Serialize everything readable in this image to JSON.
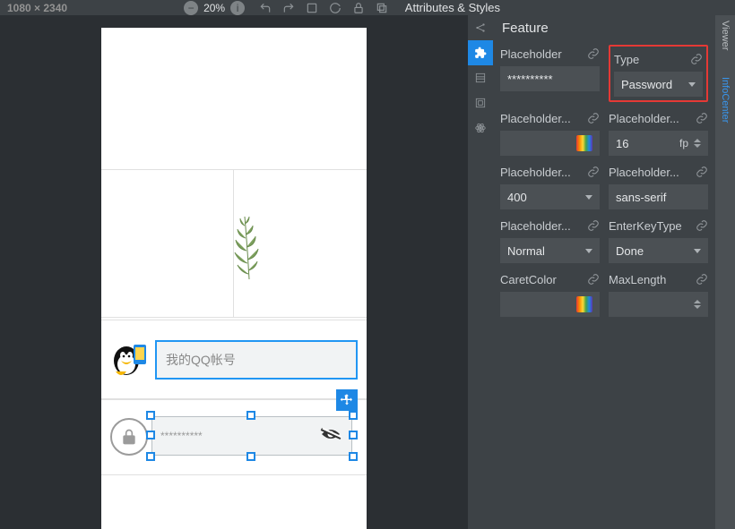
{
  "topbar": {
    "dimensions": "1080 × 2340",
    "zoom": "20%",
    "panel_title": "Attributes & Styles"
  },
  "rail": {
    "viewer": "Viewer",
    "infocenter": "InfoCenter"
  },
  "panel": {
    "section": "Feature",
    "left": {
      "placeholder_label": "Placeholder",
      "placeholder_value": "**********",
      "pcolor_label": "Placeholder...",
      "pweight_label": "Placeholder...",
      "pweight_value": "400",
      "ptype_label": "Placeholder...",
      "ptype_value": "Normal",
      "caret_label": "CaretColor"
    },
    "right": {
      "type_label": "Type",
      "type_value": "Password",
      "psize_label": "Placeholder...",
      "psize_value": "16",
      "psize_suffix": "fp",
      "pfamily_label": "Placeholder...",
      "pfamily_value": "sans-serif",
      "enter_label": "EnterKeyType",
      "enter_value": "Done",
      "maxlen_label": "MaxLength"
    }
  },
  "canvas": {
    "username_placeholder": "我的QQ帐号",
    "password_placeholder": "**********"
  }
}
